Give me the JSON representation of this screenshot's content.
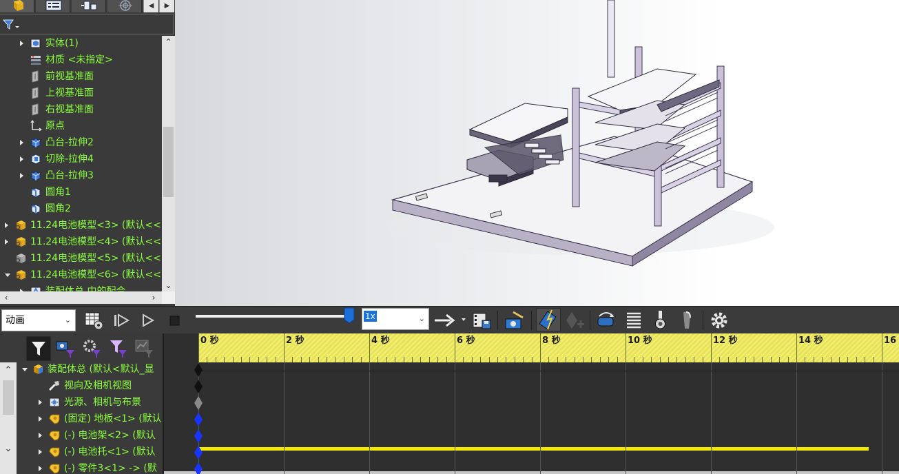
{
  "feature_tree": {
    "items": [
      {
        "label": "实体(1)",
        "icon": "solid-bodies-icon",
        "expander": "collapsed",
        "indent": 1,
        "color": "green"
      },
      {
        "label": "材质 <未指定>",
        "icon": "material-icon",
        "expander": "none",
        "indent": 1,
        "color": "green"
      },
      {
        "label": "前视基准面",
        "icon": "plane-icon",
        "expander": "none",
        "indent": 1,
        "color": "green"
      },
      {
        "label": "上视基准面",
        "icon": "plane-icon",
        "expander": "none",
        "indent": 1,
        "color": "green"
      },
      {
        "label": "右视基准面",
        "icon": "plane-icon",
        "expander": "none",
        "indent": 1,
        "color": "green"
      },
      {
        "label": "原点",
        "icon": "origin-icon",
        "expander": "none",
        "indent": 1,
        "color": "green"
      },
      {
        "label": "凸台-拉伸2",
        "icon": "boss-extrude-icon",
        "expander": "collapsed",
        "indent": 1,
        "color": "green"
      },
      {
        "label": "切除-拉伸4",
        "icon": "cut-extrude-icon",
        "expander": "collapsed",
        "indent": 1,
        "color": "green"
      },
      {
        "label": "凸台-拉伸3",
        "icon": "boss-extrude-icon",
        "expander": "collapsed",
        "indent": 1,
        "color": "green"
      },
      {
        "label": "圆角1",
        "icon": "fillet-icon",
        "expander": "none",
        "indent": 1,
        "color": "green"
      },
      {
        "label": "圆角2",
        "icon": "fillet-icon",
        "expander": "none",
        "indent": 1,
        "color": "green"
      },
      {
        "label": "11.24电池模型<3> (默认<<",
        "icon": "part-icon",
        "expander": "collapsed",
        "indent": 0,
        "color": "green"
      },
      {
        "label": "11.24电池模型<4> (默认<<",
        "icon": "part-icon",
        "expander": "collapsed",
        "indent": 0,
        "color": "green"
      },
      {
        "label": "11.24电池模型<5> (默认<<",
        "icon": "part-suppressed-icon",
        "expander": "none",
        "indent": 0,
        "color": "green"
      },
      {
        "label": "11.24电池模型<6> (默认<<",
        "icon": "part-icon",
        "expander": "expanded",
        "indent": 0,
        "color": "green"
      },
      {
        "label": "装配体总 中的配合",
        "icon": "mates-icon",
        "expander": "collapsed",
        "indent": 1,
        "color": "green"
      }
    ]
  },
  "motion_study": {
    "study_type": "动画",
    "playback_rate": "1x",
    "slider_position": 1.0,
    "ruler": {
      "labels": [
        "0 秒",
        "2 秒",
        "4 秒",
        "6 秒",
        "8 秒",
        "10 秒",
        "12 秒",
        "14 秒",
        "16"
      ],
      "max_seconds": 16
    },
    "tree": [
      {
        "label": "装配体总 (默认<默认_显",
        "icon": "assembly-icon",
        "expander": "expanded",
        "indent": 0,
        "keyframe": "black"
      },
      {
        "label": "视向及相机视图",
        "icon": "view-camera-icon",
        "expander": "none",
        "indent": 1,
        "keyframe": "black"
      },
      {
        "label": "光源、相机与布景",
        "icon": "lights-icon",
        "expander": "collapsed",
        "indent": 1,
        "keyframe": "gray"
      },
      {
        "label": "(固定) 地板<1> (默认",
        "icon": "component-icon",
        "expander": "collapsed",
        "indent": 1,
        "keyframe": "blue"
      },
      {
        "label": "(-) 电池架<2> (默认",
        "icon": "component-icon",
        "expander": "collapsed",
        "indent": 1,
        "keyframe": "blue"
      },
      {
        "label": "(-) 电池托<1> (默认",
        "icon": "component-icon",
        "expander": "collapsed",
        "indent": 1,
        "keyframe": "blue"
      },
      {
        "label": "(-) 零件3<1> -> (默",
        "icon": "component-icon",
        "expander": "collapsed",
        "indent": 1,
        "keyframe": "blue"
      }
    ],
    "timebar_end_seconds": 15.7,
    "colors": {
      "ruler": "#f3f06a",
      "timebar": "#f5e800",
      "keyframe_blue": "#1a35ff",
      "tree_text": "#8cff3c"
    }
  }
}
